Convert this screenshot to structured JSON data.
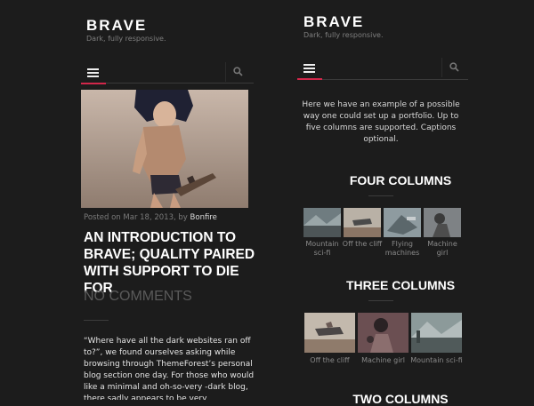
{
  "site": {
    "title": "BRAVE",
    "tagline": "Dark, fully responsive."
  },
  "nav": {
    "menu_icon": "hamburger-icon",
    "search_icon": "search-icon"
  },
  "colors": {
    "background": "#1c1c1c",
    "accent": "#d2274a",
    "heading": "#ffffff",
    "muted": "#7a7a7a"
  },
  "post": {
    "meta_prefix": "Posted on Mar 18, 2013, by",
    "author": "Bonfire",
    "title": "AN INTRODUCTION TO BRAVE; QUALITY PAIRED WITH SUPPORT TO DIE FOR",
    "comments": "NO COMMENTS",
    "excerpt": "“Where have all the dark websites ran off to?”, we found ourselves asking while browsing through ThemeForest’s personal blog section one day. For those who would like a minimal and oh-so-very -dark blog, there sadly appears to be very"
  },
  "portfolio": {
    "intro": "Here we have an example of a possible way one could set up a portfolio. Up to five columns are supported. Captions optional.",
    "sections": [
      {
        "title": "FOUR COLUMNS",
        "items": [
          {
            "caption": "Mountain sci-fi"
          },
          {
            "caption": "Off the cliff"
          },
          {
            "caption": "Flying machines"
          },
          {
            "caption": "Machine girl"
          }
        ]
      },
      {
        "title": "THREE COLUMNS",
        "items": [
          {
            "caption": "Off the cliff"
          },
          {
            "caption": "Machine girl"
          },
          {
            "caption": "Mountain sci-fi"
          }
        ]
      },
      {
        "title": "TWO COLUMNS",
        "items": []
      }
    ]
  }
}
